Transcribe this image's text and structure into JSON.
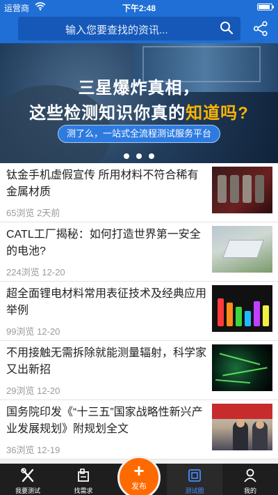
{
  "status_bar": {
    "carrier": "运营商",
    "time": "下午2:48",
    "battery_level": 0.9
  },
  "search": {
    "placeholder": "输入您要查找的资讯...",
    "icon": "search-icon",
    "share_icon": "share-icon"
  },
  "banner": {
    "headline_1": "三星爆炸真相，",
    "headline_2_prefix": "这些检测知识你真的",
    "headline_2_highlight": "知道吗?",
    "tagline": "测了么，一站式全流程测试服务平台",
    "carousel_pages": 3,
    "highlight_color": "#ffb400"
  },
  "news": [
    {
      "title": "钛金手机虚假宣传 所用材料不符合稀有金属材质",
      "meta": "65浏览 2天前"
    },
    {
      "title": "CATL工厂揭秘：如何打造世界第一安全的电池?",
      "meta": "224浏览 12-20"
    },
    {
      "title": "超全面锂电材料常用表征技术及经典应用举例",
      "meta": "99浏览 12-20"
    },
    {
      "title": "不用接触无需拆除就能测量辐射，科学家又出新招",
      "meta": "29浏览 12-20"
    },
    {
      "title": "国务院印发《“十三五”国家战略性新兴产业发展规划》附规划全文",
      "meta": "36浏览 12-19"
    }
  ],
  "tabs": [
    {
      "label": "我要测试",
      "icon": "tools-icon"
    },
    {
      "label": "找需求",
      "icon": "demand-icon"
    },
    {
      "label": "测试圈",
      "icon": "circle-icon",
      "active": true
    },
    {
      "label": "我的",
      "icon": "user-icon"
    }
  ],
  "publish": {
    "label": "发布",
    "symbol": "+"
  },
  "colors": {
    "primary": "#1f6fd6",
    "accent_orange": "#ff6a00",
    "active_tab": "#4a8cff",
    "tab_bar_bg": "#1e1e1e"
  }
}
